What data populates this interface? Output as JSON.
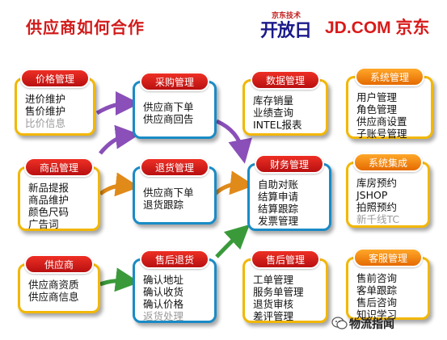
{
  "title": "供应商如何合作",
  "logos": {
    "kaifang_small": "京东技术",
    "kaifang_big": "开放日",
    "jd": "JD.COM 京东"
  },
  "cards": {
    "price": {
      "label": "价格管理",
      "items": [
        "进价维护",
        "售价维护",
        "比价信息"
      ]
    },
    "goods": {
      "label": "商品管理",
      "items": [
        "新品提报",
        "商品维护",
        "颜色尺码",
        "广告词"
      ]
    },
    "supplier": {
      "label": "供应商",
      "items": [
        "供应商资质",
        "供应商信息"
      ]
    },
    "purchase": {
      "label": "采购管理",
      "items": [
        "供应商下单",
        "供应商回告"
      ]
    },
    "returns": {
      "label": "退货管理",
      "items": [
        "供应商下单",
        "退货跟踪"
      ]
    },
    "aftersale_returns": {
      "label": "售后退货",
      "items": [
        "确认地址",
        "确认收货",
        "确认价格",
        "返货处理"
      ]
    },
    "data": {
      "label": "数据管理",
      "items": [
        "库存销量",
        "业绩查询",
        "INTEL报表"
      ]
    },
    "finance": {
      "label": "财务管理",
      "items": [
        "自助对账",
        "结算申请",
        "结算跟踪",
        "发票管理"
      ]
    },
    "aftersale": {
      "label": "售后管理",
      "items": [
        "工单管理",
        "服务单管理",
        "退货审核",
        "差评管理"
      ]
    },
    "system": {
      "label": "系统管理",
      "items": [
        "用户管理",
        "角色管理",
        "供应商设置",
        "子账号管理"
      ]
    },
    "integration": {
      "label": "系统集成",
      "items": [
        "库房预约",
        "JSHOP",
        "拍照预约",
        "新千线TC"
      ]
    },
    "service": {
      "label": "客服管理",
      "items": [
        "售前咨询",
        "客单跟踪",
        "售后咨询",
        "知识学习"
      ]
    }
  },
  "watermark": "物流指闻",
  "colors": {
    "title_red": "#d21b1b",
    "yellow_border": "#f2b705",
    "blue_border": "#1a8bc6",
    "pill_red": "#d81e1e",
    "pill_orange": "#f28a12",
    "arrow_purple": "#8a4fb8",
    "arrow_orange": "#e08a1a",
    "arrow_green": "#3a9a3a"
  }
}
